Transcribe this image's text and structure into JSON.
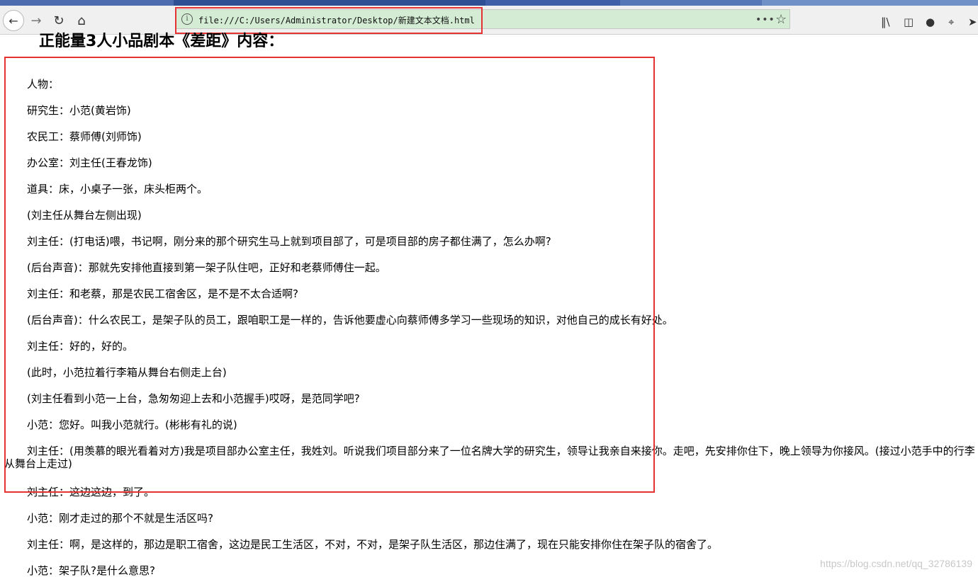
{
  "browser": {
    "url": "file:///C:/Users/Administrator/Desktop/新建文本文档.html",
    "page_actions_label": "•••",
    "icons": [
      "back-icon",
      "forward-icon",
      "reload-icon",
      "home-icon",
      "info-icon",
      "star-icon",
      "library-icon",
      "sidebar-icon",
      "chat-icon",
      "crop-icon",
      "extension-icon"
    ]
  },
  "page": {
    "title": "正能量3人小品剧本《差距》内容：",
    "paragraphs": [
      "人物：",
      "研究生：小范(黄岩饰)",
      "农民工：蔡师傅(刘师饰)",
      "办公室：刘主任(王春龙饰)",
      "道具：床，小桌子一张，床头柜两个。",
      "(刘主任从舞台左侧出现)",
      "刘主任：(打电话)喂，书记啊，刚分来的那个研究生马上就到项目部了，可是项目部的房子都住满了，怎么办啊?",
      "(后台声音)：那就先安排他直接到第一架子队住吧，正好和老蔡师傅住一起。",
      "刘主任：和老蔡，那是农民工宿舍区，是不是不太合适啊?",
      "(后台声音)：什么农民工，是架子队的员工，跟咱职工是一样的，告诉他要虚心向蔡师傅多学习一些现场的知识，对他自己的成长有好处。",
      "刘主任：好的，好的。",
      "(此时，小范拉着行李箱从舞台右侧走上台)",
      "(刘主任看到小范一上台，急匆匆迎上去和小范握手)哎呀，是范同学吧?",
      "小范：您好。叫我小范就行。(彬彬有礼的说)",
      "刘主任：(用羡慕的眼光看着对方)我是项目部办公室主任，我姓刘。听说我们项目部分来了一位名牌大学的研究生，领导让我亲自来接你。走吧，先安排你住下，晚上领导为你接风。(接过小范手中的行李从舞台上走过)",
      "刘主任：这边这边，到了。",
      "小范：刚才走过的那个不就是生活区吗?",
      "刘主任：啊，是这样的，那边是职工宿舍，这边是民工生活区，不对，不对，是架子队生活区，那边住满了，现在只能安排你住在架子队的宿舍了。",
      "小范：架子队?是什么意思?"
    ]
  },
  "watermark": "https://blog.csdn.net/qq_32786139",
  "colors": {
    "highlight_border": "#e53333",
    "urlbar_bg": "#d3ecd3",
    "toolbar_bg": "#f0f0f0"
  }
}
